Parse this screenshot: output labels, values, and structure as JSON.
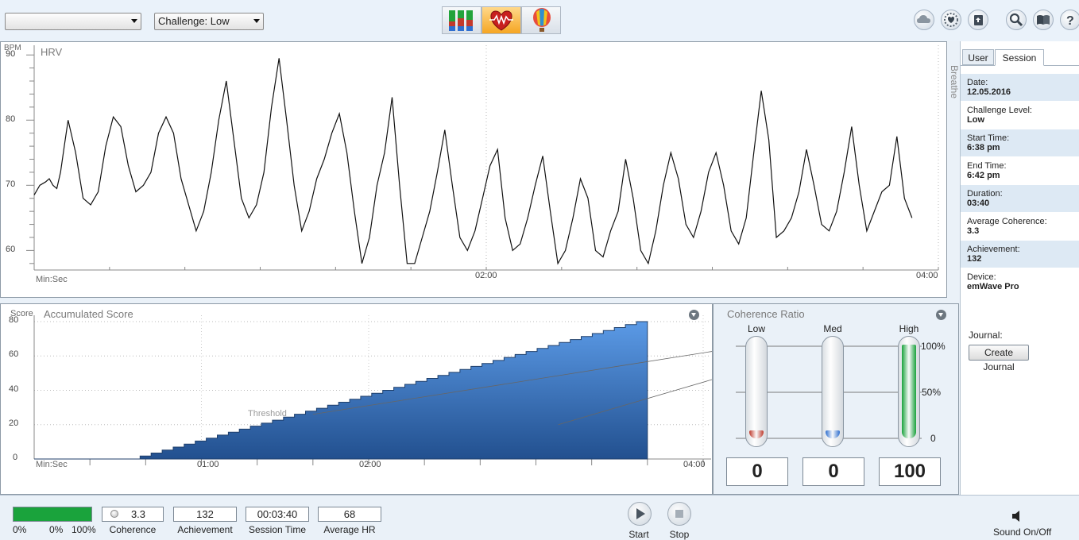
{
  "toolbar": {
    "user_combo_value": "",
    "challenge_combo_value": "Challenge: Low"
  },
  "hrv": {
    "title": "HRV",
    "y_unit": "BPM",
    "x_unit": "Min:Sec",
    "side_label": "Breathe"
  },
  "score": {
    "title": "Accumulated Score",
    "y_unit": "Score",
    "x_unit": "Min:Sec",
    "threshold_label": "Threshold"
  },
  "chart_data": [
    {
      "type": "line",
      "title": "HRV",
      "ylabel": "BPM",
      "xlabel": "Min:Sec",
      "ylim": [
        57,
        91
      ],
      "xlim_seconds": [
        0,
        240
      ],
      "x_ticks": [
        "02:00",
        "04:00"
      ],
      "y_ticks": [
        60,
        70,
        80,
        90
      ],
      "grid": true,
      "series": [
        {
          "x_seconds": [
            0,
            1.5,
            3,
            4,
            5,
            6,
            7,
            8,
            9,
            11,
            13,
            15,
            17,
            19,
            21,
            23,
            25,
            27,
            29,
            31,
            33,
            35,
            37,
            39,
            41,
            43,
            45,
            47,
            49,
            51,
            53,
            55,
            57,
            59,
            61,
            63,
            65,
            67,
            69,
            71,
            73,
            75,
            77,
            79,
            81,
            83,
            85,
            87,
            89,
            91,
            93,
            95,
            97,
            99,
            101,
            103,
            105,
            107,
            109,
            111,
            113,
            115,
            117,
            119,
            121,
            123,
            125,
            127,
            129,
            131,
            133,
            135,
            137,
            139,
            141,
            143,
            145,
            147,
            149,
            151,
            153,
            155,
            157,
            159,
            161,
            163,
            165,
            167,
            169,
            171,
            173,
            175,
            177,
            179,
            181,
            183,
            185,
            187,
            189,
            191,
            193,
            195,
            197,
            199,
            201,
            203,
            205,
            207,
            209,
            211,
            213,
            215,
            217,
            219,
            221,
            223,
            225,
            227,
            229,
            231,
            233
          ],
          "values": [
            68.5,
            70,
            70.5,
            71,
            70,
            69.5,
            72,
            76,
            80,
            75,
            68,
            67,
            69,
            76,
            80.5,
            79,
            73,
            69,
            70,
            72,
            78,
            80.5,
            78,
            71,
            67,
            63,
            66,
            72,
            80,
            86,
            77,
            68,
            65,
            67,
            72,
            82,
            89.5,
            80,
            70,
            63,
            66,
            71,
            74,
            78,
            81,
            75,
            66,
            58,
            62,
            70,
            75,
            83.5,
            70,
            58,
            58,
            62,
            66,
            72,
            78.5,
            70,
            62,
            60,
            63,
            68,
            73,
            75.5,
            65,
            60,
            61,
            65,
            70,
            74.5,
            66,
            58,
            60,
            65,
            71,
            68,
            60,
            59,
            63,
            66,
            74,
            68,
            60,
            58,
            63,
            70,
            75,
            71,
            64,
            62,
            66,
            72,
            75,
            70,
            63,
            61,
            65,
            75,
            84.5,
            77,
            62,
            63,
            65,
            69,
            75.5,
            70,
            64,
            63,
            66,
            72,
            79,
            70,
            63,
            66,
            69,
            70,
            77.5,
            68,
            65
          ]
        }
      ]
    },
    {
      "type": "area",
      "title": "Accumulated Score",
      "ylabel": "Score",
      "xlabel": "Min:Sec",
      "ylim": [
        0,
        80
      ],
      "xlim_seconds": [
        0,
        240
      ],
      "x_ticks": [
        "01:00",
        "02:00",
        "04:00"
      ],
      "y_ticks": [
        0,
        20,
        40,
        60,
        80
      ],
      "final_score": 80,
      "end_seconds": 220,
      "start_seconds": 38,
      "step_count": 46,
      "threshold_lines": [
        {
          "from": [
            130,
            84
          ],
          "to": [
            256,
            26
          ]
        },
        {
          "from": [
            240,
            49
          ],
          "to": [
            250,
            27
          ]
        }
      ]
    }
  ],
  "coherence": {
    "title": "Coherence Ratio",
    "columns": [
      {
        "label": "Low",
        "percent": 0,
        "color": "#c0392b",
        "value": "0"
      },
      {
        "label": "Med",
        "percent": 0,
        "color": "#2f6fd0",
        "value": "0"
      },
      {
        "label": "High",
        "percent": 100,
        "color": "#1aa33c",
        "value": "100"
      }
    ],
    "scale_labels": [
      "100%",
      "50%",
      "0"
    ]
  },
  "side": {
    "tabs": [
      "User",
      "Session"
    ],
    "active_tab": "Session",
    "rows": [
      {
        "label": "Date:",
        "value": "12.05.2016"
      },
      {
        "label": "Challenge Level:",
        "value": "Low"
      },
      {
        "label": "Start Time:",
        "value": "6:38 pm"
      },
      {
        "label": "End Time:",
        "value": "6:42 pm"
      },
      {
        "label": "Duration:",
        "value": "03:40"
      },
      {
        "label": "Average Coherence:",
        "value": "3.3"
      },
      {
        "label": "Achievement:",
        "value": "132"
      },
      {
        "label": "Device:",
        "value": "emWave Pro"
      }
    ],
    "journal_label": "Journal:",
    "create_journal": "Create Journal"
  },
  "bottom": {
    "progress_percent": 100,
    "progress_color": "#1aa33c",
    "progress_left_label": "0%",
    "progress_mid_label": "0%",
    "progress_right_label": "100%",
    "coherence_value": "3.3",
    "coherence_label": "Coherence",
    "achievement_value": "132",
    "achievement_label": "Achievement",
    "session_time_value": "00:03:40",
    "session_time_label": "Session Time",
    "avg_hr_value": "68",
    "avg_hr_label": "Average HR",
    "start_label": "Start",
    "stop_label": "Stop",
    "sound_label": "Sound On/Off"
  },
  "icons": [
    "bars-icon",
    "heart-wave-icon",
    "balloon-icon",
    "cloud-icon",
    "heart-gear-icon",
    "upload-icon",
    "search-icon",
    "book-icon",
    "help-icon",
    "play-icon",
    "stop-icon",
    "speaker-icon"
  ]
}
